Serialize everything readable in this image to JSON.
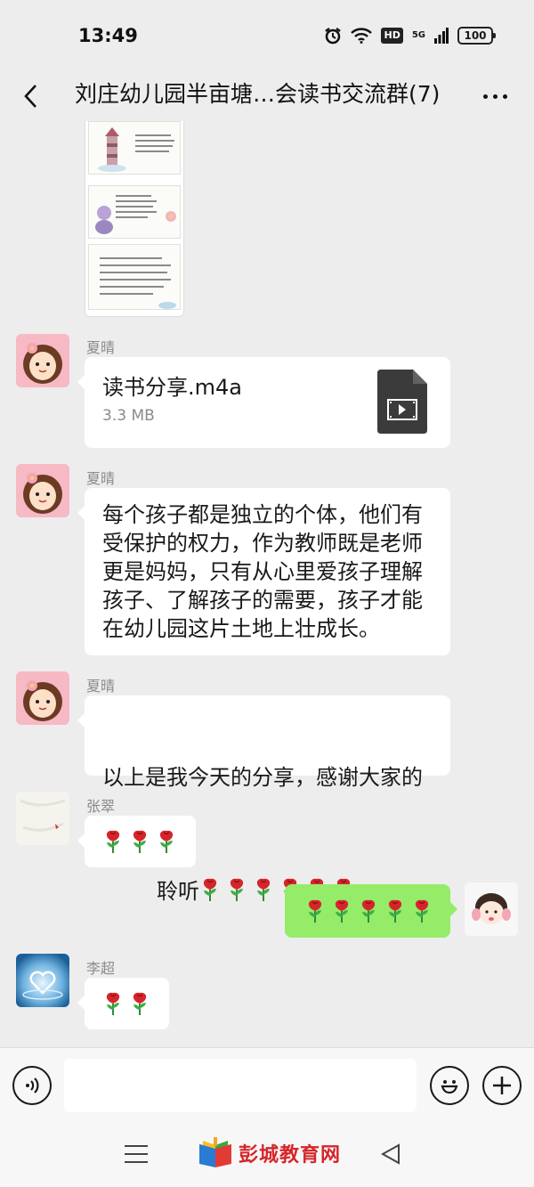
{
  "status_bar": {
    "time": "13:49",
    "network": "5G",
    "hd": "HD",
    "battery": "100"
  },
  "header": {
    "title": "刘庄幼儿园半亩塘…会读书交流群(7)",
    "back_icon": "chevron-left-icon",
    "more_icon": "more-dots-icon"
  },
  "messages": [
    {
      "type": "file",
      "sender": "夏晴",
      "file_name": "读书分享.m4a",
      "file_size": "3.3 MB"
    },
    {
      "type": "text",
      "sender": "夏晴",
      "text": "每个孩子都是独立的个体，他们有\n受保护的权力，作为教师既是老师\n更是妈妈，只有从心里爱孩子理解\n孩子、了解孩子的需要，孩子才能\n在幼儿园这片土地上壮成长。"
    },
    {
      "type": "text",
      "sender": "夏晴",
      "text_line1": "以上是我今天的分享，感谢大家的",
      "text_line2": "聆听",
      "roses": 6
    },
    {
      "type": "emoji",
      "sender": "张翠",
      "roses": 3
    },
    {
      "type": "emoji",
      "sender": "self",
      "roses": 5
    },
    {
      "type": "emoji",
      "sender": "李超",
      "roses": 2
    }
  ],
  "input_bar": {
    "voice_icon": "voice-icon",
    "emoji_icon": "emoji-face-icon",
    "plus_icon": "plus-icon",
    "placeholder": ""
  },
  "watermark": {
    "text": "彭城教育网"
  },
  "colors": {
    "background": "#ededed",
    "bubble_self": "#95ec69",
    "bubble_other": "#ffffff",
    "watermark": "#d6262a"
  }
}
